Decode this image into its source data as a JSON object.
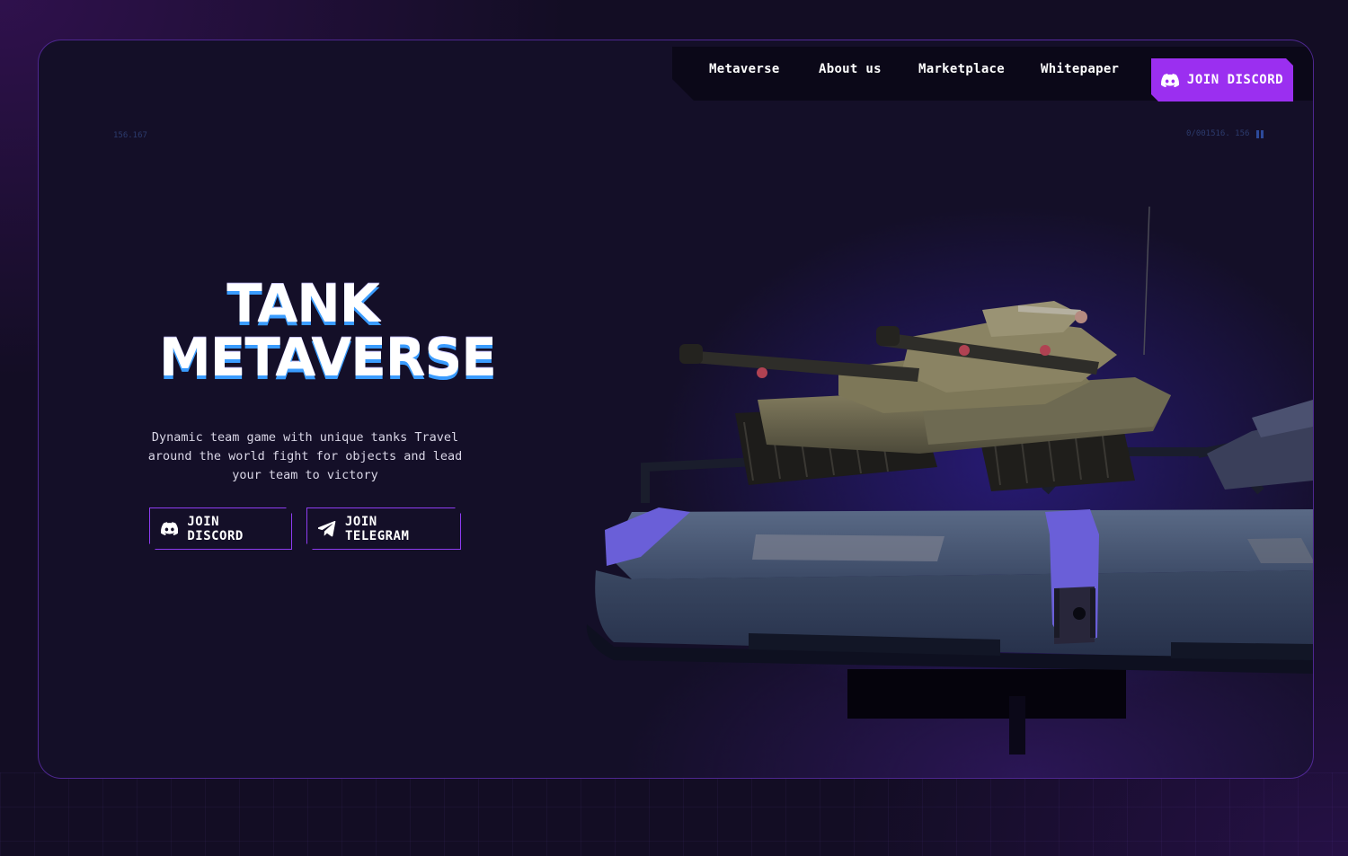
{
  "nav": {
    "items": [
      {
        "label": "Metaverse"
      },
      {
        "label": "About us"
      },
      {
        "label": "Marketplace"
      },
      {
        "label": "Whitepaper"
      }
    ],
    "discord_label": "JOIN DISCORD"
  },
  "hud": {
    "left_text": "156.167",
    "right_text": "0/001516. 156"
  },
  "hero": {
    "logo_line1": "TANK",
    "logo_line2": "METAVERSE",
    "description": "Dynamic team game with unique tanks Travel around the world fight for objects and lead your team to victory",
    "discord_button": "JOIN DISCORD",
    "telegram_button": "JOIN TELEGRAM"
  },
  "icons": {
    "discord": "discord-icon",
    "telegram": "telegram-icon"
  },
  "colors": {
    "background": "#130d24",
    "accent": "#9b2ff0",
    "border": "#8d3cf0",
    "logo_shadow": "#3a9cff",
    "platform": "#3b4a66",
    "platform_clamp": "#6a5fd8"
  }
}
